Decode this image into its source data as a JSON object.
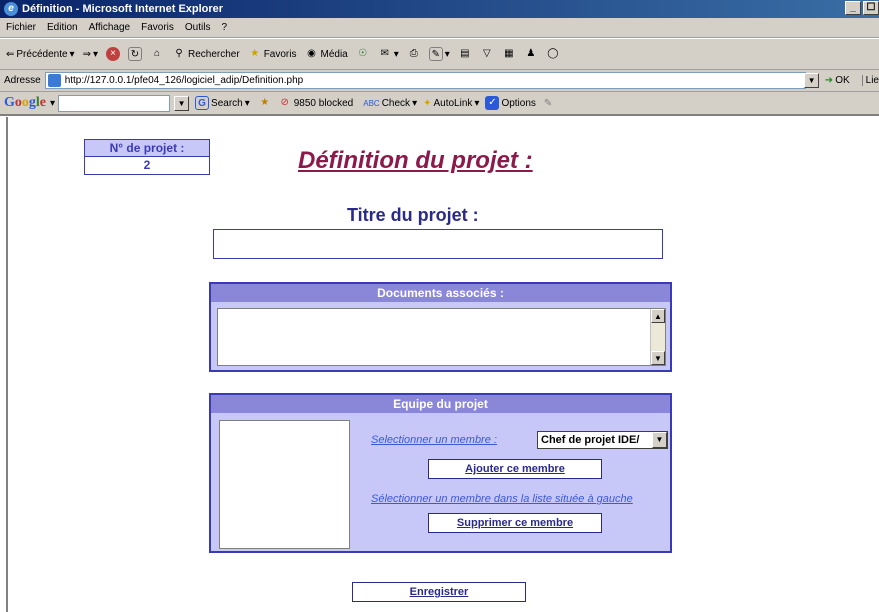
{
  "window": {
    "title": "Définition - Microsoft Internet Explorer",
    "controls": [
      "_",
      "☐",
      "×"
    ]
  },
  "menu": [
    "Fichier",
    "Edition",
    "Affichage",
    "Favoris",
    "Outils",
    "?"
  ],
  "toolbar": {
    "back": "Précédente",
    "search": "Rechercher",
    "favorites": "Favoris",
    "media": "Média"
  },
  "address": {
    "label": "Adresse",
    "url": "http://127.0.0.1/pfe04_126/logiciel_adip/Definition.php",
    "go": "OK",
    "links": "Lie"
  },
  "google": {
    "logo": "Google",
    "search": "Search",
    "blocked": "9850 blocked",
    "check": "Check",
    "autolink": "AutoLink",
    "options": "Options"
  },
  "page": {
    "project_number_label": "N° de projet :",
    "project_number": "2",
    "main_title": "Définition du projet :",
    "title_label": "Titre du projet :",
    "title_value": "",
    "documents_header": "Documents associés :",
    "team_header": "Equipe du projet",
    "select_member_label": "Selectionner un membre :",
    "select_member_value": "Chef de projet IDE/",
    "add_member": "Ajouter ce membre",
    "select_left_label": "Sélectionner un membre dans la liste située à gauche",
    "remove_member": "Supprimer ce membre",
    "save": "Enregistrer"
  }
}
